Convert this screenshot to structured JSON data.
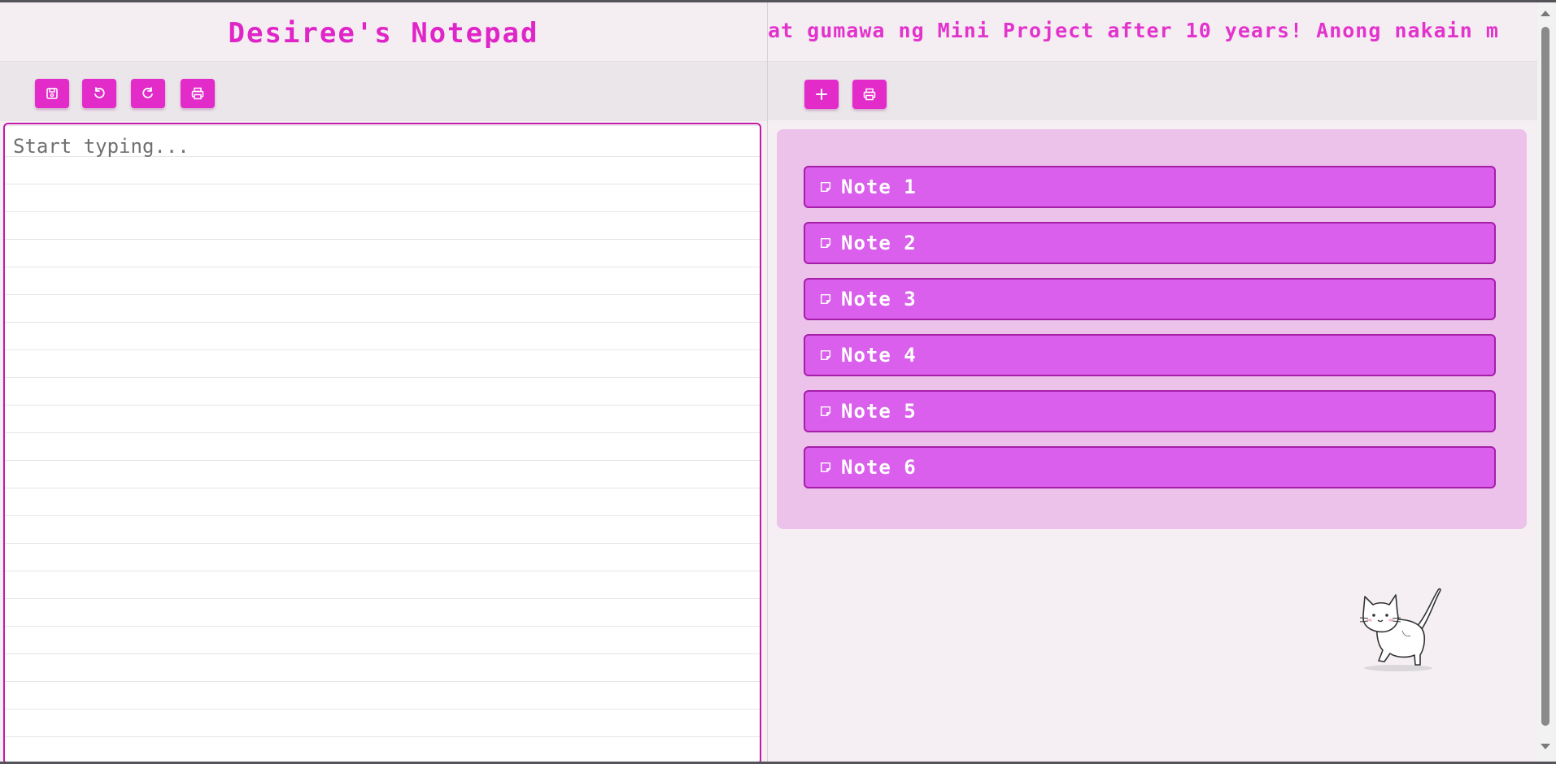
{
  "editor": {
    "title": "Desiree's Notepad",
    "placeholder": "Start typing...",
    "toolbar": {
      "save_icon": "save-icon",
      "undo_icon": "undo-icon",
      "redo_icon": "redo-icon",
      "print_icon": "print-icon"
    }
  },
  "right": {
    "marquee_text": "at gumawa ng Mini Project after 10 years! Anong nakain m",
    "toolbar": {
      "add_icon": "plus-icon",
      "print_icon": "print-icon"
    },
    "notes": [
      {
        "label": "Note 1"
      },
      {
        "label": "Note 2"
      },
      {
        "label": "Note 3"
      },
      {
        "label": "Note 4"
      },
      {
        "label": "Note 5"
      },
      {
        "label": "Note 6"
      }
    ],
    "mascot": "cat-illustration"
  },
  "colors": {
    "accent": "#e22bc9",
    "title": "#e025c8",
    "note_bg": "#d95fec",
    "note_border": "#a51fa8",
    "panel_bg": "#ecc2ea",
    "editor_border": "#c21aa6",
    "page_bg": "#f5eff3"
  }
}
